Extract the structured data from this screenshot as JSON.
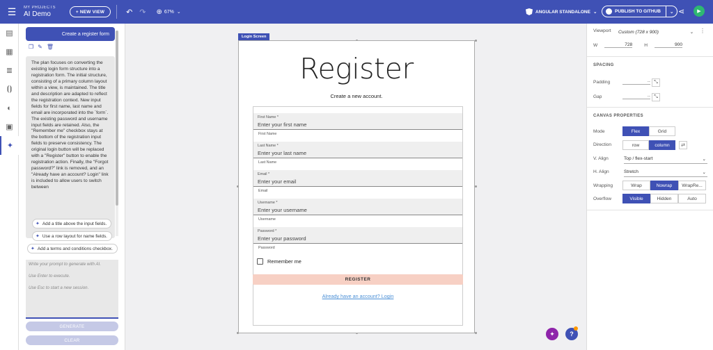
{
  "topbar": {
    "project_label": "MY PROJECTS",
    "project_name": "AI Demo",
    "new_view_label": "+ NEW VIEW",
    "zoom": "67%",
    "framework": "ANGULAR STANDALONE",
    "publish_label": "PUBLISH TO GITHUB"
  },
  "ai_panel": {
    "prompt": "Create a register form",
    "plan": "The plan focuses on converting the existing login form structure into a registration form. The initial structure, consisting of a primary column layout within a view, is maintained. The title and description are adapted to reflect the registration context. New input fields for first name, last name and email are incorporated into the `form`. The existing password and username input fields are retained. Also, the \"Remember me\" checkbox stays at the bottom of the registration input fields to preserve consistency. The original login button will be replaced with a \"Register\" button to enable the registration action. Finally, the \"Forgot password?\" link is removed, and an \"Already have an account? Login\" link is included to allow users to switch between",
    "suggestions": [
      "Add a title above the input fields.",
      "Use a row layout for name fields.",
      "Add a terms and conditions checkbox."
    ],
    "prompt_placeholder_1": "Write your prompt to generate with AI.",
    "prompt_placeholder_2": "Use Enter to execute.",
    "prompt_placeholder_3": "Use Esc to start a new session.",
    "generate_label": "GENERATE",
    "clear_label": "CLEAR"
  },
  "canvas": {
    "frame_label": "Login Screen",
    "title": "Register",
    "subtitle": "Create a new account.",
    "fields": [
      {
        "label": "First Name *",
        "placeholder": "Enter your first name",
        "hint": "First Name"
      },
      {
        "label": "Last Name *",
        "placeholder": "Enter your last name",
        "hint": "Last Name"
      },
      {
        "label": "Email *",
        "placeholder": "Enter your email",
        "hint": "Email"
      },
      {
        "label": "Username *",
        "placeholder": "Enter your username",
        "hint": "Username"
      },
      {
        "label": "Password *",
        "placeholder": "Enter your password",
        "hint": "Password"
      }
    ],
    "remember_label": "Remember me",
    "register_label": "REGISTER",
    "login_link": "Already have an account? Login"
  },
  "props": {
    "viewport_label": "Viewport",
    "viewport_value": "Custom (728 x 900)",
    "w_label": "W",
    "w_value": "728",
    "h_label": "H",
    "h_value": "900",
    "spacing_title": "SPACING",
    "padding_label": "Padding",
    "padding_value": "--",
    "gap_label": "Gap",
    "gap_value": "--",
    "canvas_title": "CANVAS PROPERTIES",
    "mode_label": "Mode",
    "mode_flex": "Flex",
    "mode_grid": "Grid",
    "direction_label": "Direction",
    "dir_row": "row",
    "dir_column": "column",
    "valign_label": "V. Align",
    "valign_value": "Top / flex-start",
    "halign_label": "H. Align",
    "halign_value": "Stretch",
    "wrapping_label": "Wrapping",
    "wrap": "Wrap",
    "nowrap": "Nowrap",
    "wrapreverse": "WrapRe...",
    "overflow_label": "Overflow",
    "visible": "Visible",
    "hidden": "Hidden",
    "auto": "Auto"
  },
  "colors": {
    "primary": "#3f51b5",
    "register_button": "#f7d0c4",
    "play": "#2eb872",
    "link": "#4a8fd6"
  }
}
